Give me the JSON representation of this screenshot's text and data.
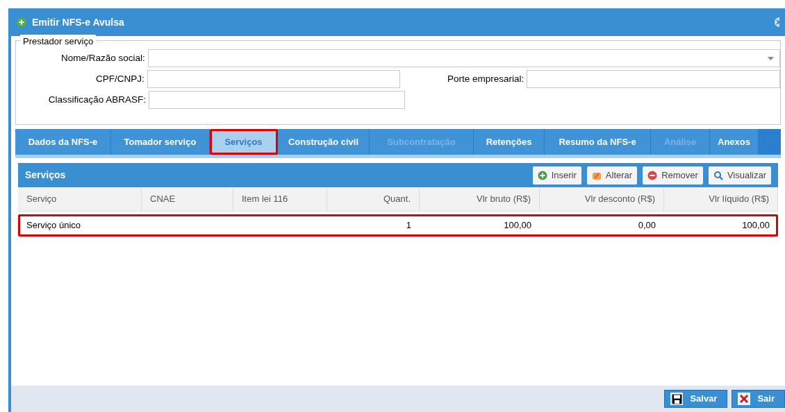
{
  "window": {
    "title": "Emitir NFS-e Avulsa"
  },
  "prestador": {
    "legend": "Prestador serviço",
    "fields": [
      {
        "label": "Nome/Razão social:",
        "kind": "select"
      },
      {
        "label": "CPF/CNPJ:",
        "kind": "text"
      },
      {
        "label": "Porte empresarial:",
        "kind": "text"
      },
      {
        "label": "Classificação ABRASF:",
        "kind": "text"
      }
    ]
  },
  "tabs": [
    {
      "label": "Dados da NFS-e",
      "selected": false,
      "disabled": false,
      "highlighted": false
    },
    {
      "label": "Tomador serviço",
      "selected": false,
      "disabled": false,
      "highlighted": false
    },
    {
      "label": "Serviços",
      "selected": true,
      "disabled": false,
      "highlighted": true
    },
    {
      "label": "Construção civil",
      "selected": false,
      "disabled": false,
      "highlighted": false
    },
    {
      "label": "Subcontratação",
      "selected": false,
      "disabled": true,
      "highlighted": false
    },
    {
      "label": "Retenções",
      "selected": false,
      "disabled": false,
      "highlighted": false
    },
    {
      "label": "Resumo da NFS-e",
      "selected": false,
      "disabled": false,
      "highlighted": false
    },
    {
      "label": "Análise",
      "selected": false,
      "disabled": true,
      "highlighted": false
    },
    {
      "label": "Anexos",
      "selected": false,
      "disabled": false,
      "highlighted": false
    }
  ],
  "grid": {
    "title": "Serviços",
    "actions": [
      {
        "label": "Inserir",
        "kind": "insert"
      },
      {
        "label": "Alterar",
        "kind": "edit"
      },
      {
        "label": "Remover",
        "kind": "remove"
      },
      {
        "label": "Visualizar",
        "kind": "view"
      }
    ],
    "columns": [
      {
        "label": "Serviço"
      },
      {
        "label": "CNAE"
      },
      {
        "label": "Item lei 116"
      },
      {
        "label": "Quant."
      },
      {
        "label": "Vlr bruto (R$)"
      },
      {
        "label": "Vlr desconto (R$)"
      },
      {
        "label": "Vlr líquido (R$)"
      }
    ],
    "rows": [
      {
        "cells": [
          "Serviço único",
          "",
          "",
          "1",
          "100,00",
          "0,00",
          "100,00"
        ],
        "highlighted": true
      }
    ]
  },
  "footer": {
    "buttons": [
      {
        "label": "Salvar",
        "kind": "save"
      },
      {
        "label": "Sair",
        "kind": "exit"
      }
    ]
  }
}
